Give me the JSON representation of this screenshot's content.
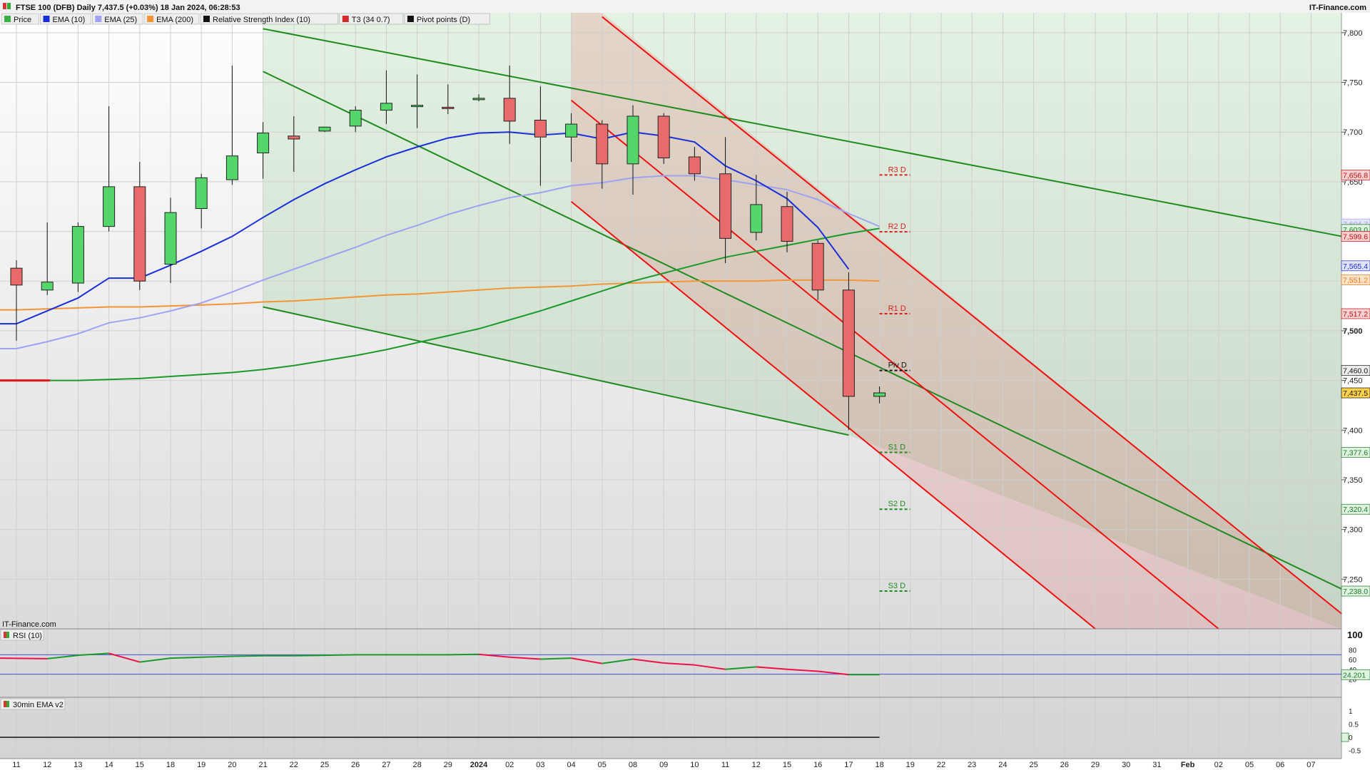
{
  "header": {
    "title": "FTSE 100 (DFB) Daily 7,437.5 (+0.03%) 18 Jan 2024, 06:28:53",
    "brand": "IT-Finance.com",
    "watermark": "IT-Finance.com"
  },
  "legend": [
    {
      "label": "Price",
      "color": "#3cb043"
    },
    {
      "label": "EMA (10)",
      "color": "#1a2fd8"
    },
    {
      "label": "EMA (25)",
      "color": "#9ea2f0"
    },
    {
      "label": "EMA (200)",
      "color": "#f39435"
    },
    {
      "label": "Relative Strength Index (10)",
      "color": "#111111"
    },
    {
      "label": "T3 (34 0.7)",
      "color": "#d62b2b"
    },
    {
      "label": "Pivot points (D)",
      "color": "#111111"
    }
  ],
  "colors": {
    "up": "#55d66b",
    "down": "#e86a6a",
    "ema10": "#1a2fd8",
    "ema25": "#9ea2f0",
    "ema200": "#f39435",
    "t3": "#1a9a2c",
    "channel_green": "#1f8a1f",
    "channel_red": "#ee1111"
  },
  "chart_data": {
    "type": "candlestick",
    "ylim": [
      7200,
      7820
    ],
    "y_ticks": [
      7250,
      7300,
      7350,
      7400,
      7450,
      7500,
      7550,
      7600,
      7650,
      7700,
      7750,
      7800
    ],
    "y_tick_labels": [
      "7,250",
      "7,300",
      "7,350",
      "7,400",
      "7,450",
      "7,500",
      "7,550",
      "7,600",
      "7,650",
      "7,700",
      "7,750",
      "7,800"
    ],
    "x_labels": [
      "11",
      "12",
      "13",
      "14",
      "15",
      "18",
      "19",
      "20",
      "21",
      "22",
      "25",
      "26",
      "27",
      "28",
      "29",
      "2024",
      "02",
      "03",
      "04",
      "05",
      "08",
      "09",
      "10",
      "11",
      "12",
      "15",
      "16",
      "17",
      "18",
      "19",
      "22",
      "23",
      "24",
      "25",
      "26",
      "29",
      "30",
      "31",
      "Feb",
      "02",
      "05",
      "06",
      "07"
    ],
    "candles": [
      {
        "o": 7563,
        "h": 7571,
        "l": 7490,
        "c": 7546
      },
      {
        "o": 7541,
        "h": 7609,
        "l": 7536,
        "c": 7549
      },
      {
        "o": 7548,
        "h": 7609,
        "l": 7539,
        "c": 7605
      },
      {
        "o": 7605,
        "h": 7726,
        "l": 7600,
        "c": 7645
      },
      {
        "o": 7645,
        "h": 7670,
        "l": 7541,
        "c": 7550
      },
      {
        "o": 7567,
        "h": 7634,
        "l": 7548,
        "c": 7619
      },
      {
        "o": 7623,
        "h": 7658,
        "l": 7603,
        "c": 7654
      },
      {
        "o": 7652,
        "h": 7767,
        "l": 7647,
        "c": 7676
      },
      {
        "o": 7679,
        "h": 7710,
        "l": 7653,
        "c": 7699
      },
      {
        "o": 7696,
        "h": 7716,
        "l": 7660,
        "c": 7693
      },
      {
        "o": 7701,
        "h": 7705,
        "l": 7700,
        "c": 7705
      },
      {
        "o": 7706,
        "h": 7726,
        "l": 7700,
        "c": 7722
      },
      {
        "o": 7722,
        "h": 7762,
        "l": 7708,
        "c": 7729
      },
      {
        "o": 7727,
        "h": 7758,
        "l": 7704,
        "c": 7727
      },
      {
        "o": 7725,
        "h": 7748,
        "l": 7718,
        "c": 7724
      },
      {
        "o": 7734,
        "h": 7738,
        "l": 7731,
        "c": 7734
      },
      {
        "o": 7734,
        "h": 7767,
        "l": 7688,
        "c": 7711
      },
      {
        "o": 7712,
        "h": 7746,
        "l": 7646,
        "c": 7695
      },
      {
        "o": 7695,
        "h": 7719,
        "l": 7670,
        "c": 7708
      },
      {
        "o": 7708,
        "h": 7712,
        "l": 7643,
        "c": 7668
      },
      {
        "o": 7668,
        "h": 7727,
        "l": 7637,
        "c": 7716
      },
      {
        "o": 7716,
        "h": 7719,
        "l": 7668,
        "c": 7674
      },
      {
        "o": 7675,
        "h": 7685,
        "l": 7651,
        "c": 7658
      },
      {
        "o": 7658,
        "h": 7695,
        "l": 7568,
        "c": 7593
      },
      {
        "o": 7599,
        "h": 7657,
        "l": 7591,
        "c": 7627
      },
      {
        "o": 7625,
        "h": 7640,
        "l": 7579,
        "c": 7590
      },
      {
        "o": 7588,
        "h": 7591,
        "l": 7531,
        "c": 7541
      },
      {
        "o": 7541,
        "h": 7559,
        "l": 7400,
        "c": 7434
      },
      {
        "o": 7434,
        "h": 7444,
        "l": 7427,
        "c": 7437.5
      }
    ],
    "ema10": [
      7507,
      7520,
      7533,
      7553,
      7553,
      7566,
      7580,
      7595,
      7614,
      7632,
      7648,
      7662,
      7675,
      7685,
      7694,
      7699,
      7700,
      7697,
      7699,
      7693,
      7700,
      7696,
      7690,
      7666,
      7651,
      7633,
      7604,
      7562
    ],
    "ema25": [
      7482,
      7489,
      7497,
      7508,
      7513,
      7520,
      7528,
      7539,
      7551,
      7562,
      7573,
      7584,
      7596,
      7606,
      7617,
      7626,
      7634,
      7639,
      7646,
      7649,
      7654,
      7656,
      7656,
      7652,
      7647,
      7642,
      7632,
      7618,
      7605
    ],
    "ema200": [
      7521,
      7522,
      7523,
      7524,
      7524,
      7525,
      7526,
      7527,
      7529,
      7530,
      7532,
      7534,
      7536,
      7537,
      7539,
      7541,
      7543,
      7544,
      7545,
      7547,
      7548,
      7549,
      7550,
      7550,
      7550,
      7551,
      7551,
      7551,
      7550
    ],
    "t3": [
      7450,
      7450,
      7450,
      7451,
      7452,
      7454,
      7456,
      7458,
      7461,
      7465,
      7470,
      7475,
      7481,
      7488,
      7495,
      7502,
      7511,
      7520,
      7530,
      7540,
      7550,
      7558,
      7566,
      7574,
      7580,
      7586,
      7592,
      7598,
      7603
    ],
    "pivots": [
      {
        "label": "R3 D",
        "value": 7656.8,
        "color": "#d62020"
      },
      {
        "label": "R2 D",
        "value": 7599.6,
        "color": "#d62020"
      },
      {
        "label": "R1 D",
        "value": 7517.2,
        "color": "#d62020"
      },
      {
        "label": "Piv D",
        "value": 7460.0,
        "color": "#111111"
      },
      {
        "label": "S1 D",
        "value": 7377.6,
        "color": "#1f8a1f"
      },
      {
        "label": "S2 D",
        "value": 7320.4,
        "color": "#1f8a1f"
      },
      {
        "label": "S3 D",
        "value": 7238.0,
        "color": "#1f8a1f"
      }
    ],
    "price_tags": [
      {
        "text": "7,656.8",
        "value": 7656.8,
        "bg": "#f6d0d0",
        "fg": "#c01010"
      },
      {
        "text": "7,604.7",
        "value": 7607.5,
        "bg": "#e4e4f8",
        "fg": "#9ea2f0"
      },
      {
        "text": "7,603.0",
        "value": 7602.0,
        "bg": "#dff2df",
        "fg": "#1a7a2a"
      },
      {
        "text": "7,599.6",
        "value": 7595.0,
        "bg": "#f6d0d0",
        "fg": "#c01010"
      },
      {
        "text": "7,565.4",
        "value": 7565.4,
        "bg": "#dfe3fb",
        "fg": "#1a2fd8"
      },
      {
        "text": "7,551.2",
        "value": 7551.2,
        "bg": "#fde3c8",
        "fg": "#e07a1a"
      },
      {
        "text": "7,517.2",
        "value": 7517.2,
        "bg": "#f6d0d0",
        "fg": "#c01010"
      },
      {
        "text": "7,460.0",
        "value": 7460.0,
        "bg": "#eeeeee",
        "fg": "#111111"
      },
      {
        "text": "7,437.5",
        "value": 7437.5,
        "bg": "#ffd24a",
        "fg": "#111111"
      },
      {
        "text": "7,377.6",
        "value": 7377.6,
        "bg": "#dff2df",
        "fg": "#1a7a2a"
      },
      {
        "text": "7,320.4",
        "value": 7320.4,
        "bg": "#dff2df",
        "fg": "#1a7a2a"
      },
      {
        "text": "7,238.0",
        "value": 7238.0,
        "bg": "#dff2df",
        "fg": "#1a7a2a"
      }
    ],
    "channels": {
      "green_upper": [
        [
          8,
          7804
        ],
        [
          43,
          7595
        ]
      ],
      "green_mid": [
        [
          8,
          7761
        ],
        [
          43,
          7240
        ]
      ],
      "green_lower": [
        [
          8,
          7524
        ],
        [
          27,
          7395
        ]
      ],
      "red_upper": [
        [
          19,
          7816
        ],
        [
          43,
          7215
        ]
      ],
      "red_mid": [
        [
          18,
          7732
        ],
        [
          39,
          7200
        ]
      ],
      "red_lower": [
        [
          18,
          7630
        ],
        [
          35,
          7200
        ]
      ]
    },
    "rsi": {
      "label": "RSI (10)",
      "ylim": [
        0,
        100
      ],
      "ticks": [
        100,
        80,
        60,
        40,
        20
      ],
      "levels": [
        70,
        30
      ],
      "current": "24.201",
      "values": [
        63,
        62,
        69,
        73,
        55,
        63,
        65,
        67,
        68,
        68,
        69,
        70,
        70,
        70,
        70,
        71,
        65,
        61,
        63,
        52,
        61,
        53,
        49,
        40,
        45,
        40,
        36,
        29,
        29
      ]
    },
    "ema30": {
      "label": "30min EMA v2",
      "ylim": [
        -0.7,
        1.3
      ],
      "ticks": [
        "1",
        "0.5",
        "0",
        "-0.5"
      ],
      "value": 0
    }
  }
}
